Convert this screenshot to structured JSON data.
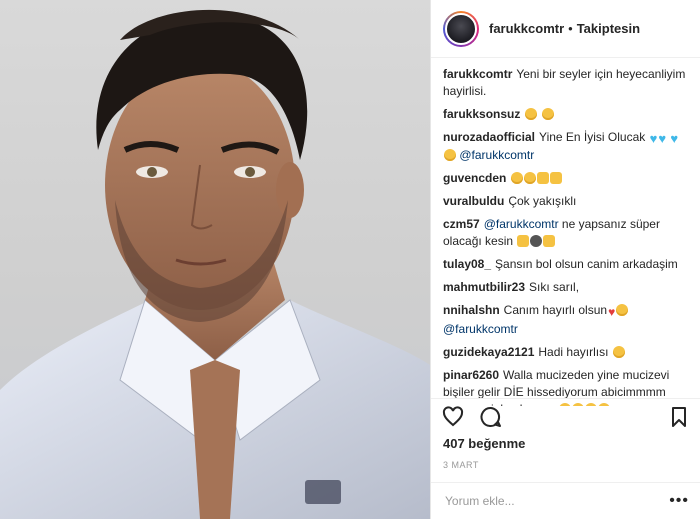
{
  "header": {
    "username": "farukkcomtr",
    "separator": "•",
    "follow_status": "Takiptesin"
  },
  "comments": [
    {
      "user": "farukkcomtr",
      "text": "Yeni bir seyler için heyecanliyim hayirlisi."
    },
    {
      "user": "farukksonsuz",
      "text": ""
    },
    {
      "user": "nurozadaofficial",
      "text": "Yine En İyisi Olucak",
      "mention": "@farukkcomtr"
    },
    {
      "user": "guvencden",
      "text": ""
    },
    {
      "user": "vuralbuldu",
      "text": "Çok yakışıklı"
    },
    {
      "user": "czm57",
      "mention": "@farukkcomtr",
      "text": "ne yapsanız süper olacağı kesin"
    },
    {
      "user": "tulay08_",
      "text": "Şansın bol olsun canim arkadaşim"
    },
    {
      "user": "mahmutbilir23",
      "text": "Sıkı sarıl,"
    },
    {
      "user": "nnihalshn",
      "text": "Canım hayırlı olsun",
      "mention": "@farukkcomtr"
    },
    {
      "user": "guzidekaya2121",
      "text": "Hadi hayırlısı"
    },
    {
      "user": "pinar6260",
      "text": "Walla mucizeden yine mucizevi bişiler gelir DİE hissediyorum abicimmmm şans seninle olsunnn"
    }
  ],
  "likes": "407 beğenme",
  "date": "3 MART",
  "add_comment": {
    "placeholder": "Yorum ekle..."
  },
  "icons": {
    "like": "heart-outline-icon",
    "comment": "comment-bubble-icon",
    "save": "bookmark-icon",
    "more": "more-dots-icon"
  },
  "colors": {
    "mention": "#003569",
    "text": "#262626",
    "muted": "#999999"
  }
}
